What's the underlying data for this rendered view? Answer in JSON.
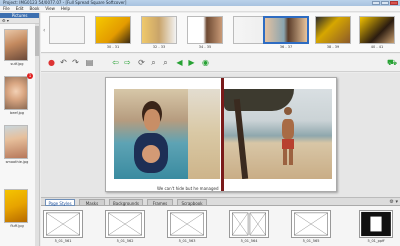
{
  "window": {
    "title": "Project: IMG0123 54/0077.07 - [Full Spread Square Softcover]"
  },
  "menu": [
    "File",
    "Edit",
    "Book",
    "View",
    "Help"
  ],
  "pictures_panel": {
    "header": "Pictures",
    "tools": "⚙ ▾",
    "items": [
      {
        "caption": "sutf.jpg"
      },
      {
        "caption": "beef.jpg",
        "badge": "1"
      },
      {
        "caption": "smoothie.jpg"
      },
      {
        "caption": "fluff.jpg"
      }
    ]
  },
  "pages": [
    {
      "caption": ""
    },
    {
      "caption": "30 - 31"
    },
    {
      "caption": "32 - 33"
    },
    {
      "caption": "34 - 35"
    },
    {
      "caption": ""
    },
    {
      "caption": "36 - 37"
    },
    {
      "caption": "38 - 39"
    },
    {
      "caption": "40 - 41"
    }
  ],
  "canvas": {
    "caption_text": "We can't hide but he managed"
  },
  "tabs": [
    "Page Styles",
    "Masks",
    "Backgrounds",
    "Frames",
    "Scrapbook"
  ],
  "tab_options": "⚙ ▾",
  "styles": [
    {
      "caption": "5_01_561"
    },
    {
      "caption": "5_01_562"
    },
    {
      "caption": "5_01_563"
    },
    {
      "caption": "5_01_564"
    },
    {
      "caption": "5_01_565"
    },
    {
      "caption": "5_01_ppff"
    }
  ],
  "colors": {
    "accent": "#2e6cc2",
    "tab_active_text": "#1b4f9c",
    "spine": "#7a1a1a"
  }
}
